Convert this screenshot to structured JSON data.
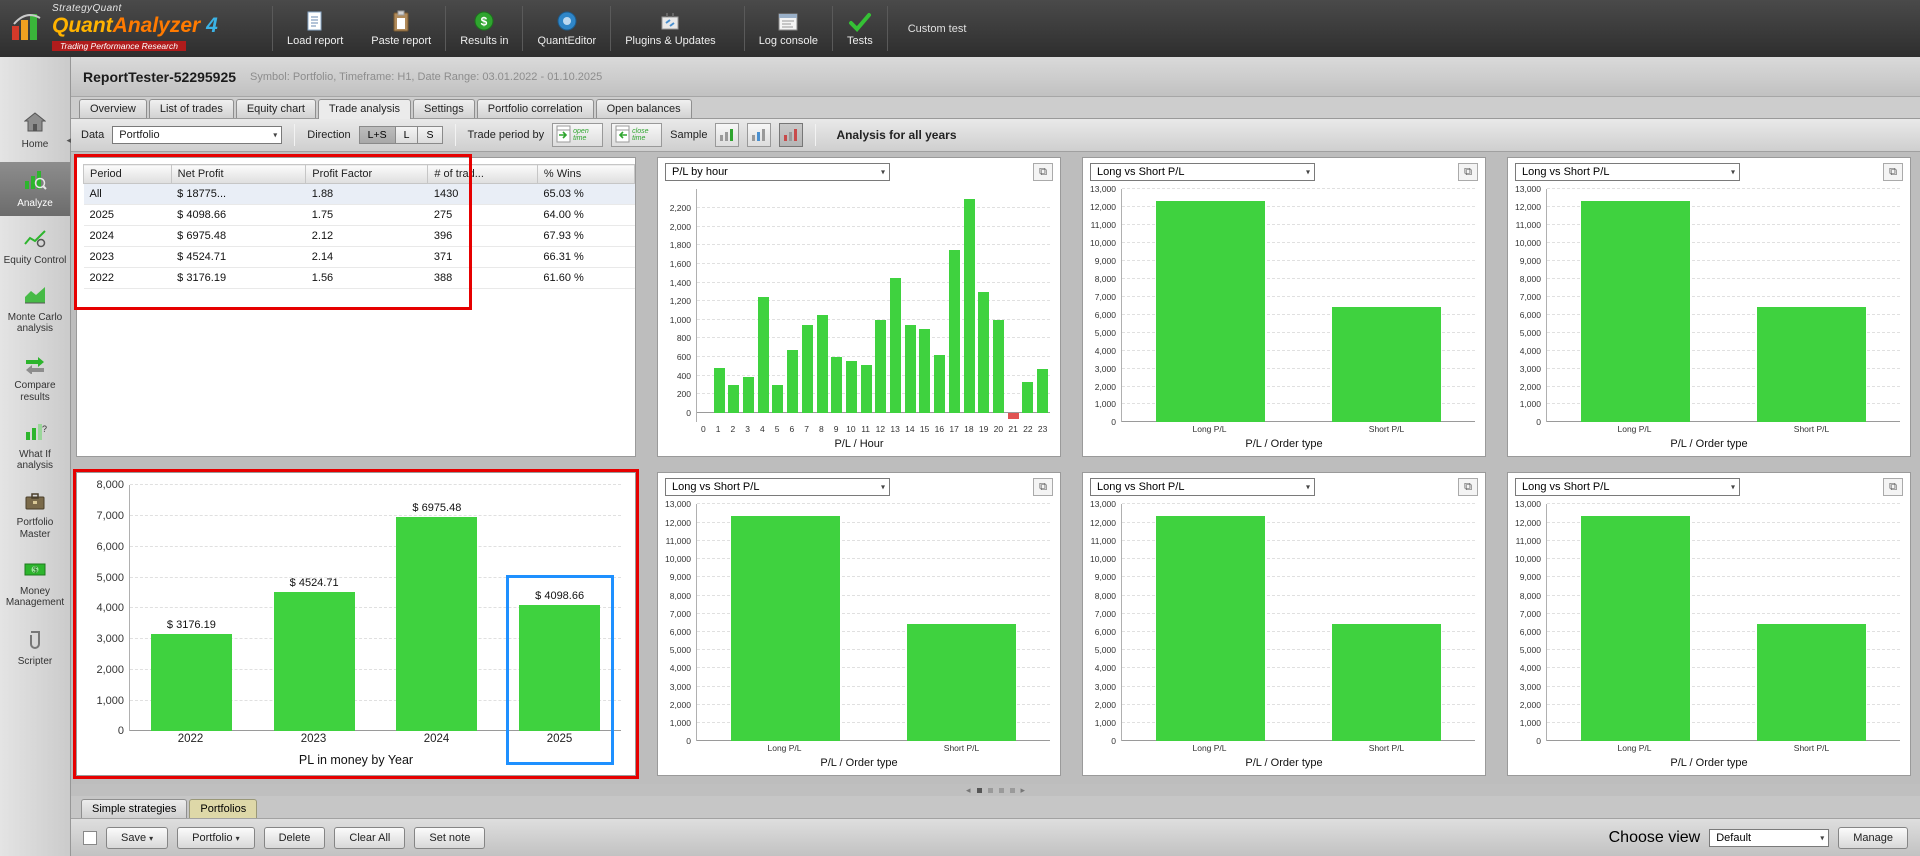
{
  "topbar": {
    "logo": {
      "strategy": "StrategyQuant",
      "brand_quant": "Quant",
      "brand_analyzer": "Analyzer",
      "version": "4",
      "tagline": "Trading Performance Research"
    },
    "buttons": [
      {
        "label": "Load report"
      },
      {
        "label": "Paste report"
      },
      {
        "label": "Results in"
      },
      {
        "label": "QuantEditor"
      },
      {
        "label": "Plugins & Updates"
      },
      {
        "label": "Log console"
      },
      {
        "label": "Tests"
      }
    ],
    "custom_label": "Custom test"
  },
  "report_header": {
    "title": "ReportTester-52295925",
    "subtitle": "Symbol: Portfolio, Timeframe: H1, Date Range: 03.01.2022 - 01.10.2025"
  },
  "tabs": {
    "items": [
      "Overview",
      "List of trades",
      "Equity chart",
      "Trade analysis",
      "Settings",
      "Portfolio correlation",
      "Open balances"
    ],
    "selected": "Trade analysis"
  },
  "filterbar": {
    "data_label": "Data",
    "data_value": "Portfolio",
    "direction_label": "Direction",
    "direction_options": [
      "L+S",
      "L",
      "S"
    ],
    "direction_selected": "L+S",
    "trade_period_label": "Trade period by",
    "open_time_label": "open time",
    "close_time_label": "close time",
    "sample_label": "Sample",
    "analysis_label": "Analysis for all years"
  },
  "sidebar": {
    "items": [
      "Home",
      "Analyze",
      "Equity Control",
      "Monte Carlo analysis",
      "Compare results",
      "What If analysis",
      "Portfolio Master",
      "Money Management",
      "Scripter"
    ],
    "selected": "Analyze"
  },
  "stats_table": {
    "columns": [
      "Period",
      "Net Profit",
      "Profit Factor",
      "# of trad...",
      "% Wins"
    ],
    "rows": [
      [
        "All",
        "$ 18775...",
        "1.88",
        "1430",
        "65.03 %"
      ],
      [
        "2025",
        "$ 4098.66",
        "1.75",
        "275",
        "64.00 %"
      ],
      [
        "2024",
        "$ 6975.48",
        "2.12",
        "396",
        "67.93 %"
      ],
      [
        "2023",
        "$ 4524.71",
        "2.14",
        "371",
        "66.31 %"
      ],
      [
        "2022",
        "$ 3176.19",
        "1.56",
        "388",
        "61.60 %"
      ]
    ]
  },
  "chart_data": [
    {
      "id": "pl_by_hour",
      "type": "bar",
      "dropdown_label": "P/L by hour",
      "xlabel": "P/L / Hour",
      "categories": [
        "0",
        "1",
        "2",
        "3",
        "4",
        "5",
        "6",
        "7",
        "8",
        "9",
        "10",
        "11",
        "12",
        "13",
        "14",
        "15",
        "16",
        "17",
        "18",
        "19",
        "20",
        "21",
        "22",
        "23"
      ],
      "values": [
        0,
        480,
        300,
        390,
        1250,
        300,
        680,
        950,
        1050,
        600,
        560,
        520,
        1000,
        1450,
        950,
        900,
        620,
        1750,
        2300,
        1300,
        1000,
        -60,
        330,
        470
      ],
      "ylim": [
        -100,
        2400
      ],
      "tick_min": 0,
      "tick_max": 2200,
      "tick_step": 200,
      "bar_color": "#3fd23f",
      "neg_color": "#e05353",
      "bar_frac": 0.75
    },
    {
      "id": "long_vs_short_pl",
      "type": "bar",
      "dropdown_label": "Long vs Short P/L",
      "xlabel": "P/L / Order type",
      "categories": [
        "Long P/L",
        "Short P/L"
      ],
      "values": [
        12350,
        6425
      ],
      "ylim": [
        0,
        13000
      ],
      "tick_min": 0,
      "tick_max": 13000,
      "tick_step": 1000,
      "bar_color": "#3fd23f",
      "bar_frac": 0.62
    },
    {
      "id": "pl_in_money_by_year",
      "type": "bar",
      "xlabel": "PL in money by Year",
      "categories": [
        "2022",
        "2023",
        "2024",
        "2025"
      ],
      "values": [
        3176.19,
        4524.71,
        6975.48,
        4098.66
      ],
      "bar_labels": [
        "$ 3176.19",
        "$ 4524.71",
        "$ 6975.48",
        "$ 4098.66"
      ],
      "ylim": [
        0,
        8000
      ],
      "tick_min": 0,
      "tick_max": 8000,
      "tick_step": 1000,
      "bar_color": "#3fd23f",
      "bar_frac": 0.66,
      "big": true,
      "highlight_index": 3,
      "highlight_color": "#1e90ff"
    }
  ],
  "pager": {
    "prev": "◂",
    "next": "▸"
  },
  "bottom_tabs": {
    "items": [
      "Simple strategies",
      "Portfolios"
    ],
    "selected": "Portfolios"
  },
  "bottom_bar": {
    "save_label": "Save",
    "portfolio_label": "Portfolio",
    "delete_label": "Delete",
    "clear_all_label": "Clear All",
    "set_note_label": "Set note",
    "choose_view_label": "Choose view",
    "view_value": "Default",
    "manage_label": "Manage"
  },
  "icons": {
    "dropdown_arrow": "▾",
    "popout": "⧉"
  },
  "annotations": {
    "red": "#e60000",
    "blue": "#1e90ff"
  }
}
